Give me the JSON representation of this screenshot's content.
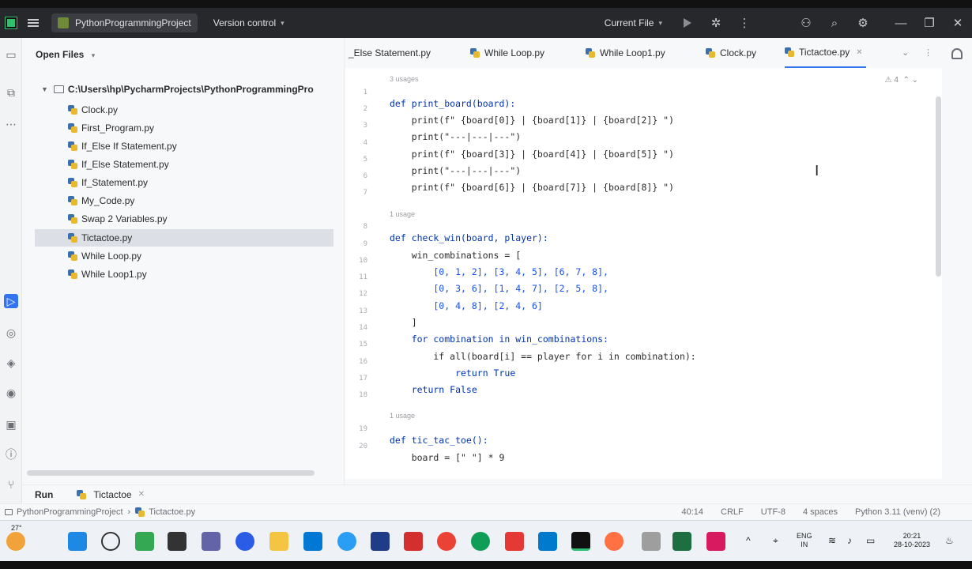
{
  "titlebar": {
    "project_name": "PythonProgrammingProject",
    "vcs_label": "Version control",
    "run_config": "Current File"
  },
  "project_panel": {
    "header": "Open Files",
    "root_path": "C:\\Users\\hp\\PycharmProjects\\PythonProgrammingPro",
    "files": [
      "Clock.py",
      "First_Program.py",
      "If_Else If Statement.py",
      "If_Else Statement.py",
      "If_Statement.py",
      "My_Code.py",
      "Swap 2 Variables.py",
      "Tictactoe.py",
      "While Loop.py",
      "While Loop1.py"
    ],
    "selected_file": "Tictactoe.py"
  },
  "tabs": [
    {
      "label": "_Else Statement.py",
      "active": false
    },
    {
      "label": "While Loop.py",
      "active": false
    },
    {
      "label": "While Loop1.py",
      "active": false
    },
    {
      "label": "Clock.py",
      "active": false
    },
    {
      "label": "Tictactoe.py",
      "active": true
    }
  ],
  "editor": {
    "warnings": "4",
    "usages": [
      "3 usages",
      "1 usage",
      "1 usage"
    ],
    "line_numbers": [
      "1",
      "2",
      "3",
      "4",
      "5",
      "6",
      "7",
      "8",
      "9",
      "10",
      "11",
      "12",
      "13",
      "14",
      "15",
      "16",
      "17",
      "18",
      "19",
      "20"
    ],
    "lines": [
      "def print_board(board):",
      "    print(f\" {board[0]} | {board[1]} | {board[2]} \")",
      "    print(\"---|---|---\")",
      "    print(f\" {board[3]} | {board[4]} | {board[5]} \")",
      "    print(\"---|---|---\")",
      "    print(f\" {board[6]} | {board[7]} | {board[8]} \")",
      "",
      "def check_win(board, player):",
      "    win_combinations = [",
      "        [0, 1, 2], [3, 4, 5], [6, 7, 8],",
      "        [0, 3, 6], [1, 4, 7], [2, 5, 8],",
      "        [0, 4, 8], [2, 4, 6]",
      "    ]",
      "    for combination in win_combinations:",
      "        if all(board[i] == player for i in combination):",
      "            return True",
      "    return False",
      "",
      "def tic_tac_toe():",
      "    board = [\" \"] * 9"
    ]
  },
  "run_bar": {
    "label": "Run",
    "config": "Tictactoe"
  },
  "status_bar": {
    "breadcrumb_project": "PythonProgrammingProject",
    "breadcrumb_file": "Tictactoe.py",
    "position": "40:14",
    "line_ending": "CRLF",
    "encoding": "UTF-8",
    "indent": "4 spaces",
    "interpreter": "Python 3.11 (venv) (2)"
  },
  "taskbar": {
    "weather": "27°",
    "lang_top": "ENG",
    "lang_bottom": "IN",
    "time": "20:21",
    "date": "28-10-2023"
  }
}
